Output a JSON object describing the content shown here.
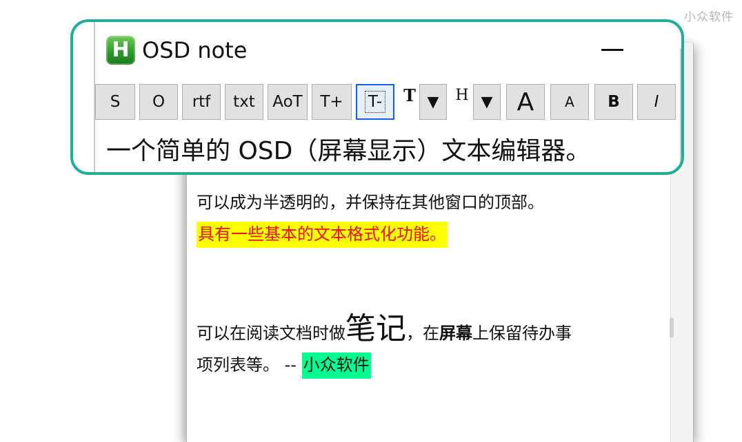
{
  "watermark": "小众软件",
  "window": {
    "title": "OSD note",
    "logo_letter": "H",
    "minimize_icon": "minimize-icon"
  },
  "toolbar": {
    "buttons": [
      {
        "id": "s",
        "label": "S"
      },
      {
        "id": "o",
        "label": "O"
      },
      {
        "id": "rtf",
        "label": "rtf"
      },
      {
        "id": "txt",
        "label": "txt"
      },
      {
        "id": "aot",
        "label": "AoT"
      },
      {
        "id": "t-plus",
        "label": "T+"
      },
      {
        "id": "t-minus",
        "label": "T-",
        "active": true
      },
      {
        "id": "text-color-glyph",
        "label": "T"
      },
      {
        "id": "text-color-dropdown",
        "label": "▼"
      },
      {
        "id": "highlight-glyph",
        "label": "H"
      },
      {
        "id": "highlight-dropdown",
        "label": "▼"
      },
      {
        "id": "font-bigger",
        "label": "A"
      },
      {
        "id": "font-smaller",
        "label": "A"
      },
      {
        "id": "bold",
        "label": "B"
      },
      {
        "id": "italic",
        "label": "I"
      }
    ]
  },
  "callout_line": "一个简单的 OSD（屏幕显示）文本编辑器。",
  "document": {
    "line1": "可以成为半透明的，并保持在其他窗口的顶部。",
    "line2": "具有一些基本的文本格式化功能。",
    "line3_prefix": "可以在阅读文档时做",
    "line3_big": "笔记",
    "line3_mid": "，在",
    "line3_bold": "屏幕",
    "line3_suffix": "上保留待办事",
    "line4_prefix": "项列表等。 -- ",
    "line4_highlight": "小众软件"
  },
  "colors": {
    "callout_border": "#1fae97",
    "highlight_yellow": "#ffff00",
    "highlight_text_red": "#e8101c",
    "highlight_green": "#00ff90"
  }
}
